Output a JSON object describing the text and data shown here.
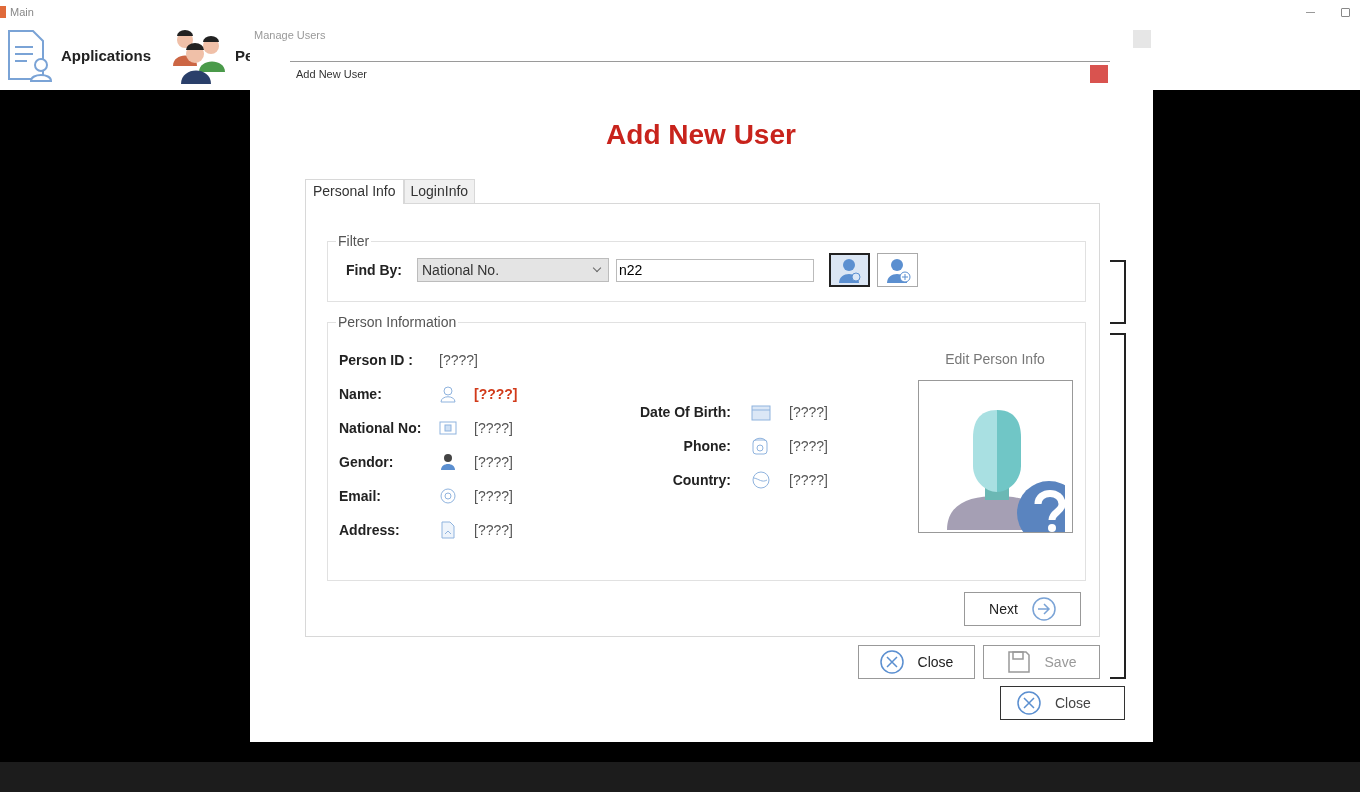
{
  "main_window": {
    "title": "Main",
    "toolbar": [
      {
        "label": "Applications",
        "kind": "applications"
      },
      {
        "label": "Pe",
        "kind": "people"
      }
    ]
  },
  "manage_users_window": {
    "title": "Manage Users",
    "close_button": "Close"
  },
  "dialog": {
    "title": "Add New User",
    "heading": "Add New User",
    "tabs": [
      {
        "label": "Personal Info",
        "selected": true
      },
      {
        "label": "LoginInfo",
        "selected": false
      }
    ],
    "filter": {
      "title": "Filter",
      "find_by_label": "Find By:",
      "find_by": "National No.",
      "search_value": "n22",
      "buttons": [
        {
          "kind": "find",
          "selected": true
        },
        {
          "kind": "add",
          "selected": false
        }
      ]
    },
    "person_information": {
      "title": "Person Information",
      "person_id_label": "Person ID :",
      "person_id": "[????]",
      "edit_link": "Edit Person Info",
      "fields_left": [
        {
          "label": "Name:",
          "kind": "name",
          "value": "[????]",
          "highlight": true
        },
        {
          "label": "National No:",
          "kind": "national_no",
          "value": "[????]",
          "highlight": false
        },
        {
          "label": "Gendor:",
          "kind": "gender",
          "value": "[????]",
          "highlight": false
        },
        {
          "label": "Email:",
          "kind": "email",
          "value": "[????]",
          "highlight": false
        },
        {
          "label": "Address:",
          "kind": "address",
          "value": "[????]",
          "highlight": false
        }
      ],
      "fields_right": [
        {
          "label": "Date Of Birth:",
          "kind": "date",
          "value": "[????]",
          "highlight": false
        },
        {
          "label": "Phone:",
          "kind": "phone",
          "value": "[????]",
          "highlight": false
        },
        {
          "label": "Country:",
          "kind": "country",
          "value": "[????]",
          "highlight": false
        }
      ]
    },
    "next_button": {
      "label": "Next",
      "disabled": false
    },
    "buttons": [
      {
        "label": "Close",
        "kind": "close",
        "disabled": false
      },
      {
        "label": "Save",
        "kind": "save",
        "disabled": true
      }
    ]
  }
}
